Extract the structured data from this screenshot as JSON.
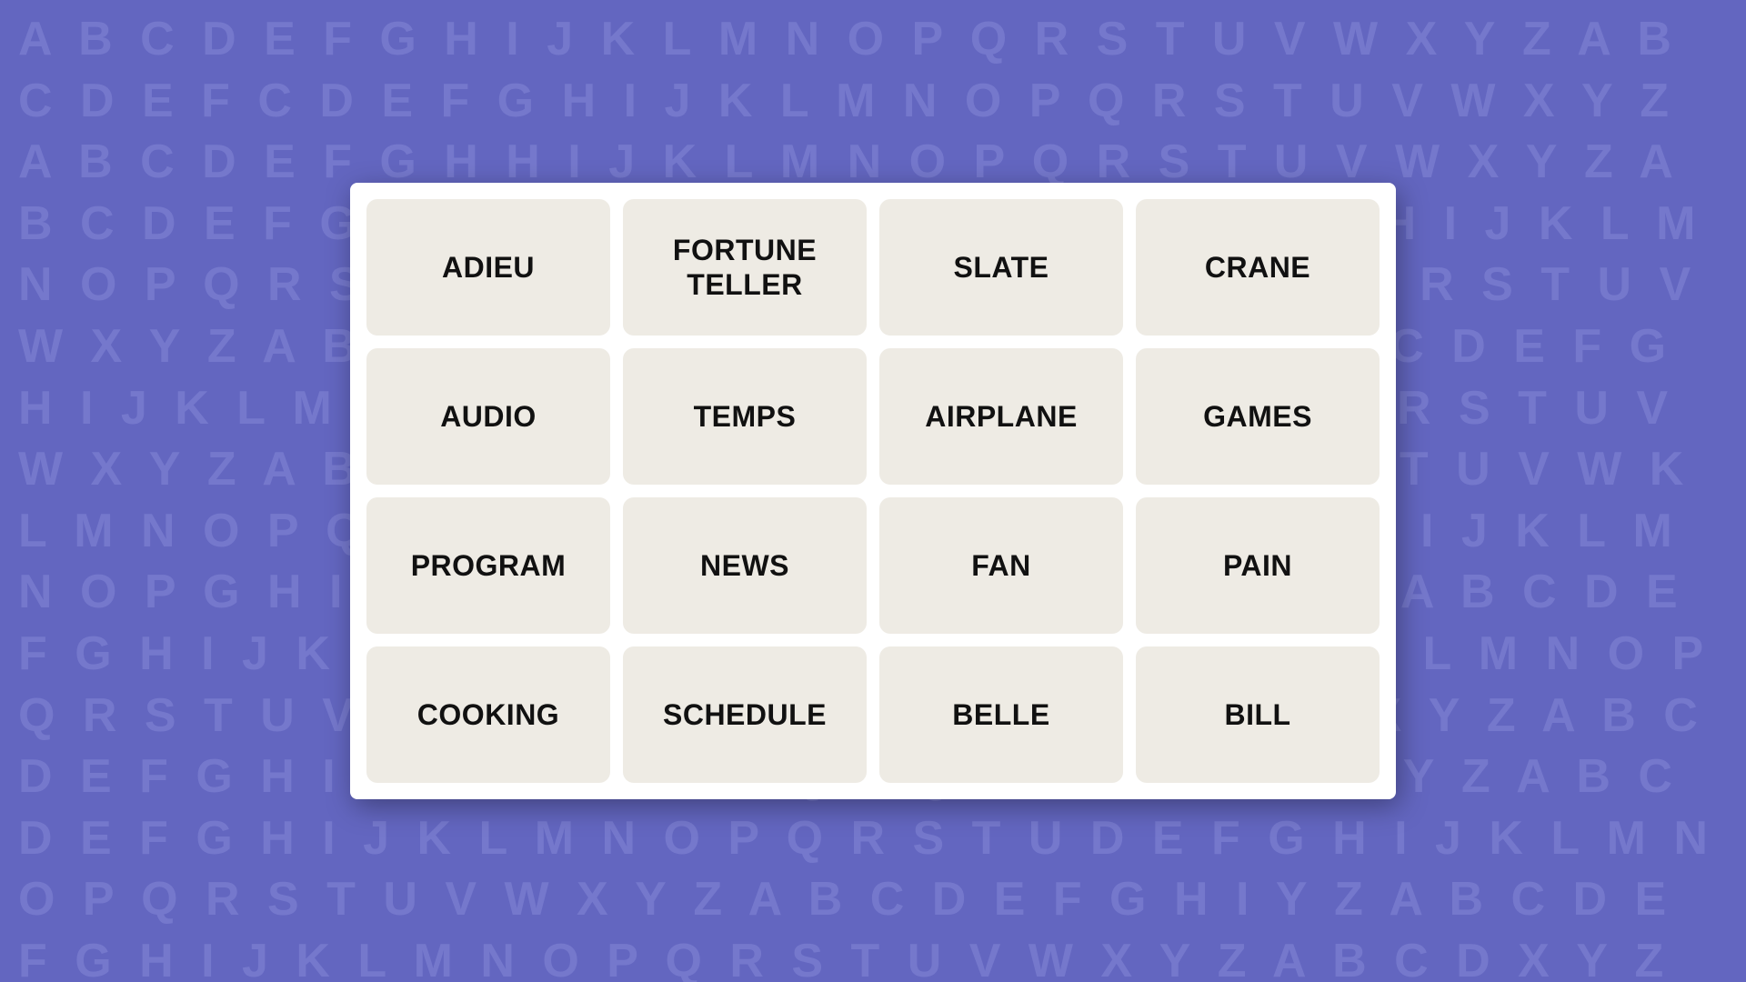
{
  "background": {
    "alphabet_text": "A B C D E F G H I J K L M N O P Q R S T U V W X Y Z A B C D E F G H I J K L M N O P Q R S T U V W X Y Z A B C D E F G H I J K L M N O P Q R S T U V W X Y Z A B C D E F G H I J K L M N O P Q R S T U V W X Y Z A B C D E F G H I J K L M N O P Q R S T U V W X Y Z A B C D E F G H I J K L M N O P Q R S T U V W X Y Z A B C D E F G H I J K L M N O P Q R S T U V W X Y Z A B C D E F G H I J K L M N O P Q R S T U V W X Y Z A B C D E F G H I J K L M N O P Q R S T U V W X Y Z A B C D E F G H I J K L M N O P Q R S T U V W X Y Z A B C D E F G H I J K L M N O P Q R S T U V W X Y Z A B C D E F G H I J K L M N O P Q R S T U V W X Y Z A B C D E F G H I J K L M N O P Q R S T U V W X Y Z A B C D E F G H I J K L M N O P Q R S T U V W X Y Z A B C D E F G H I J K L M N O P Q R S T U V W X Y Z A B C D E F G H I J K L M N O P Q R S T U V W X Y Z"
  },
  "grid": {
    "cells": [
      {
        "id": "cell-0",
        "label": "ADIEU"
      },
      {
        "id": "cell-1",
        "label": "FORTUNE TELLER"
      },
      {
        "id": "cell-2",
        "label": "SLATE"
      },
      {
        "id": "cell-3",
        "label": "CRANE"
      },
      {
        "id": "cell-4",
        "label": "AUDIO"
      },
      {
        "id": "cell-5",
        "label": "TEMPS"
      },
      {
        "id": "cell-6",
        "label": "AIRPLANE"
      },
      {
        "id": "cell-7",
        "label": "GAMES"
      },
      {
        "id": "cell-8",
        "label": "PROGRAM"
      },
      {
        "id": "cell-9",
        "label": "NEWS"
      },
      {
        "id": "cell-10",
        "label": "FAN"
      },
      {
        "id": "cell-11",
        "label": "PAIN"
      },
      {
        "id": "cell-12",
        "label": "COOKING"
      },
      {
        "id": "cell-13",
        "label": "SCHEDULE"
      },
      {
        "id": "cell-14",
        "label": "BELLE"
      },
      {
        "id": "cell-15",
        "label": "BILL"
      }
    ]
  }
}
